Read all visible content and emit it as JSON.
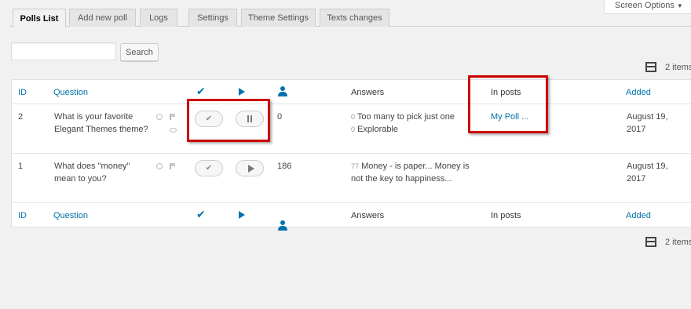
{
  "screen_options": {
    "label": "Screen Options",
    "arrow": "▼"
  },
  "tabs": [
    {
      "label": "Polls List",
      "active": true
    },
    {
      "label": "Add new poll"
    },
    {
      "label": "Logs"
    },
    {
      "label": "Settings"
    },
    {
      "label": "Theme Settings"
    },
    {
      "label": "Texts changes"
    }
  ],
  "search": {
    "placeholder": "",
    "value": "",
    "button_label": "Search"
  },
  "items_count_top": "2 items",
  "items_count_bottom": "2 items",
  "columns": {
    "id": "ID",
    "question": "Question",
    "check": "✔",
    "answers": "Answers",
    "in_posts": "In posts",
    "added": "Added"
  },
  "rows": [
    {
      "id": "2",
      "question_l1": "What is your favorite",
      "question_l2": "Elegant Themes theme?",
      "votes": "0",
      "answer1_count": "0",
      "answer1_text": "Too many to pick just one",
      "answer2_count": "0",
      "answer2_text": "Explorable",
      "in_posts": "My Poll ...",
      "added_l1": "August 19,",
      "added_l2": "2017",
      "state": "paused"
    },
    {
      "id": "1",
      "question_l1": "What does \"money\"",
      "question_l2": "mean to you?",
      "votes": "186",
      "answer1_count": "77",
      "answer1_text": "Money - is paper... Money is",
      "answer2_text": "not the key to happiness...",
      "in_posts": "",
      "added_l1": "August 19,",
      "added_l2": "2017",
      "state": "stopped"
    }
  ],
  "colors": {
    "accent": "#0073aa",
    "highlight": "#cc0000"
  }
}
